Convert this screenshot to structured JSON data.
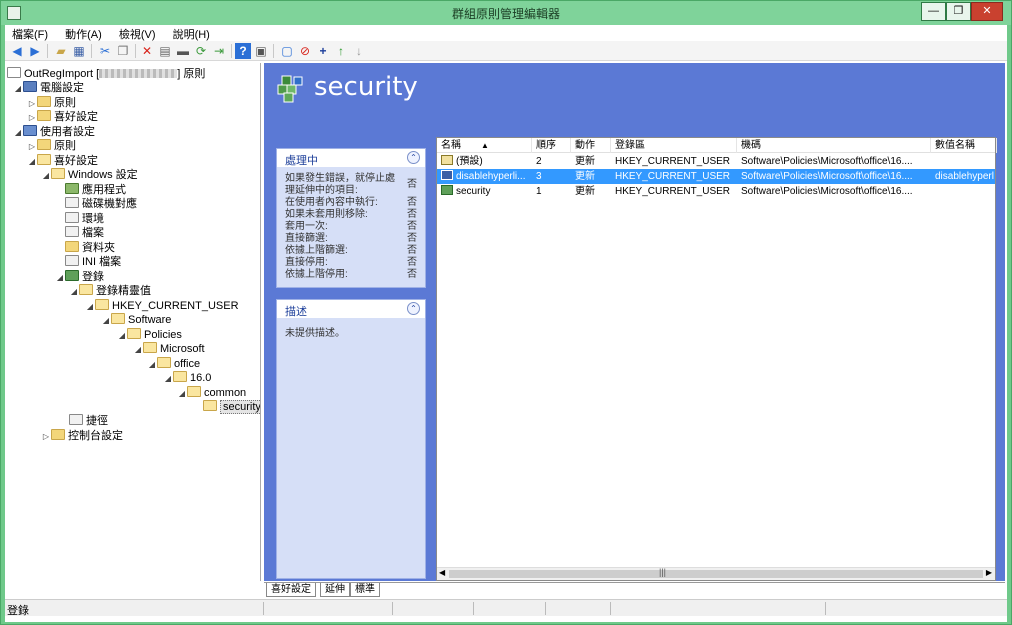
{
  "window": {
    "title": "群組原則管理編輯器",
    "buttons": {
      "minimize": "—",
      "maximize": "❐",
      "close": "✕"
    }
  },
  "menu": [
    "檔案(F)",
    "動作(A)",
    "檢視(V)",
    "說明(H)"
  ],
  "toolbar_icons": [
    "back-arrow-icon",
    "forward-arrow-icon",
    "up-folder-icon",
    "show-hide-tree-icon",
    "cut-icon",
    "copy-icon",
    "delete-icon",
    "properties-icon",
    "print-icon",
    "refresh-icon",
    "export-icon",
    "help-icon",
    "view-icon",
    "new-icon",
    "stop-icon",
    "add-icon",
    "move-up-icon",
    "move-down-icon"
  ],
  "tree": {
    "root": "OutRegImport [",
    "root_suffix": "] 原則",
    "computer_config": "電腦設定",
    "c_policies": "原則",
    "c_preferences": "喜好設定",
    "user_config": "使用者設定",
    "u_policies": "原則",
    "u_preferences": "喜好設定",
    "windows_settings": "Windows 設定",
    "applications": "應用程式",
    "drive_maps": "磁碟機對應",
    "environment": "環境",
    "files": "檔案",
    "folders": "資料夾",
    "ini_files": "INI 檔案",
    "registry": "登錄",
    "registry_wizard": "登錄精靈值",
    "hkcu": "HKEY_CURRENT_USER",
    "software": "Software",
    "policies": "Policies",
    "microsoft": "Microsoft",
    "office": "office",
    "ver": "16.0",
    "common": "common",
    "security": "security",
    "shortcuts": "捷徑",
    "control_panel": "控制台設定"
  },
  "main": {
    "title": "security",
    "processing_panel": {
      "header": "處理中",
      "rows": [
        {
          "label": "如果發生錯誤，就停止處理延伸中的項目:",
          "value": "否"
        },
        {
          "label": "在使用者內容中執行:",
          "value": "否"
        },
        {
          "label": "如果未套用則移除:",
          "value": "否"
        },
        {
          "label": "套用一次:",
          "value": "否"
        },
        {
          "label": "直接篩選:",
          "value": "否"
        },
        {
          "label": "依據上階篩選:",
          "value": "否"
        },
        {
          "label": "直接停用:",
          "value": "否"
        },
        {
          "label": "依據上階停用:",
          "value": "否"
        }
      ]
    },
    "description_panel": {
      "header": "描述",
      "text": "未提供描述。"
    },
    "list": {
      "columns": [
        "名稱",
        "順序",
        "動作",
        "登錄區",
        "機碼",
        "數值名稱"
      ],
      "rows": [
        {
          "name": "(預設)",
          "order": "2",
          "action": "更新",
          "hive": "HKEY_CURRENT_USER",
          "key": "Software\\Policies\\Microsoft\\office\\16....",
          "value_name": ""
        },
        {
          "name": "disablehyperli...",
          "order": "3",
          "action": "更新",
          "hive": "HKEY_CURRENT_USER",
          "key": "Software\\Policies\\Microsoft\\office\\16....",
          "value_name": "disablehyperl"
        },
        {
          "name": "security",
          "order": "1",
          "action": "更新",
          "hive": "HKEY_CURRENT_USER",
          "key": "Software\\Policies\\Microsoft\\office\\16....",
          "value_name": ""
        }
      ],
      "selected_row": 1
    },
    "tabs": [
      "喜好設定",
      "延伸",
      "標準"
    ]
  },
  "status": {
    "text": "登錄"
  },
  "colors": {
    "accent_blue": "#5b79d5",
    "selection": "#3399ff",
    "frame_green": "#6fc98a"
  }
}
